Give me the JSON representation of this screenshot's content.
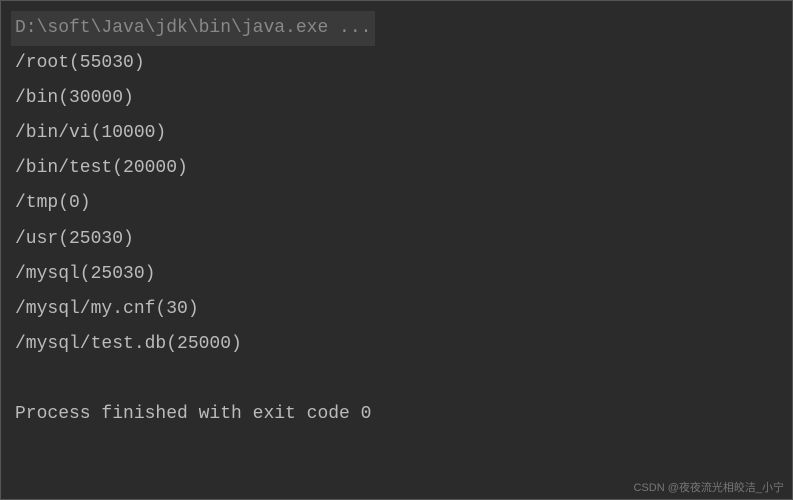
{
  "console": {
    "command": "D:\\soft\\Java\\jdk\\bin\\java.exe ...",
    "lines": [
      "/root(55030)",
      "/bin(30000)",
      "/bin/vi(10000)",
      "/bin/test(20000)",
      "/tmp(0)",
      "/usr(25030)",
      "/mysql(25030)",
      "/mysql/my.cnf(30)",
      "/mysql/test.db(25000)"
    ],
    "exit_message": "Process finished with exit code 0"
  },
  "watermark": "CSDN @夜夜流光相皎洁_小宁"
}
